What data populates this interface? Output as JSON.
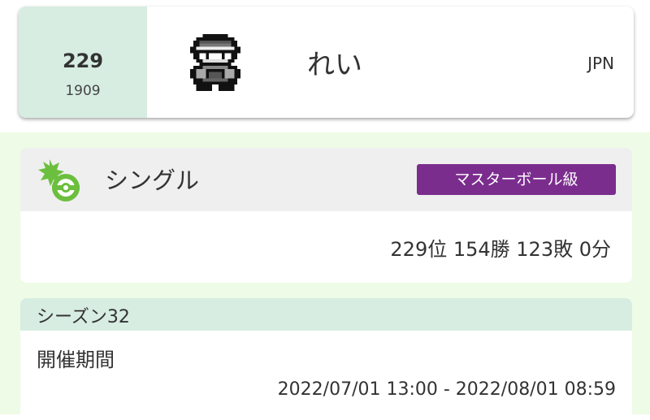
{
  "player": {
    "rank": "229",
    "rating": "1909",
    "name": "れい",
    "country": "JPN",
    "avatar_icon": "trainer-avatar-icon"
  },
  "battle": {
    "type_label": "シングル",
    "type_icon": "single-battle-icon",
    "class_badge": "マスターボール級",
    "record": "229位 154勝 123敗 0分"
  },
  "season": {
    "title": "シーズン32",
    "period_label": "開催期間",
    "period_value": "2022/07/01 13:00 - 2022/08/01 08:59"
  },
  "colors": {
    "accent_green": "#d7ede2",
    "page_bg": "#eefbe6",
    "badge_purple": "#7b2d8e",
    "icon_green": "#6cbf3e"
  }
}
